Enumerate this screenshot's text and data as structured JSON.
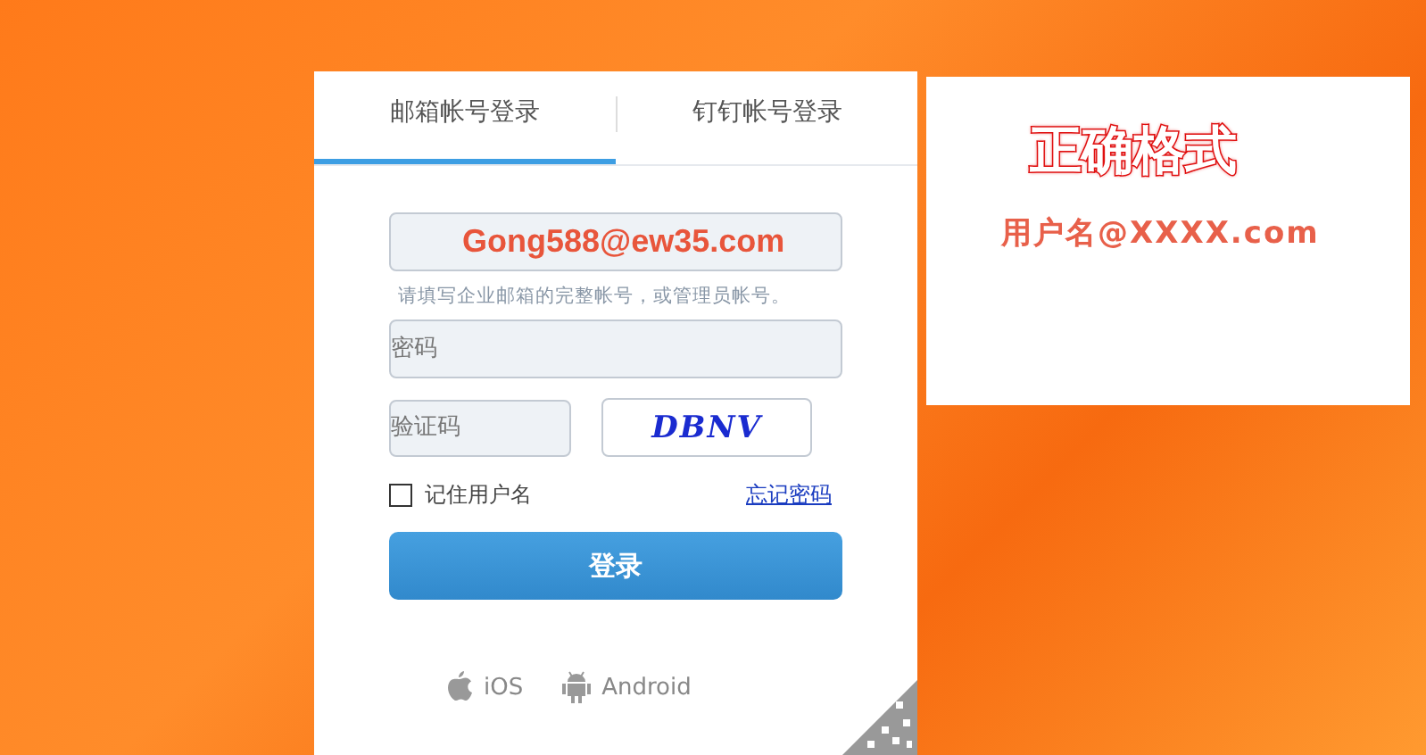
{
  "tabs": [
    {
      "label": "邮箱帐号登录",
      "selected": true
    },
    {
      "label": "钉钉帐号登录",
      "selected": false
    }
  ],
  "email_field": {
    "value": "Gong588@ew35.com"
  },
  "hint": "请填写企业邮箱的完整帐号，或管理员帐号。",
  "password_field": {
    "placeholder": "密码"
  },
  "captcha_field": {
    "placeholder": "验证码"
  },
  "captcha_image": {
    "text": "DBNV"
  },
  "remember": {
    "label": "记住用户名",
    "checked": false
  },
  "forgot_link": "忘记密码",
  "login_button": "登录",
  "apps": [
    {
      "kind": "ios",
      "label": "iOS"
    },
    {
      "kind": "android",
      "label": "Android"
    }
  ],
  "note": {
    "title": "正确格式",
    "example": "用户名@XXXX.com"
  }
}
